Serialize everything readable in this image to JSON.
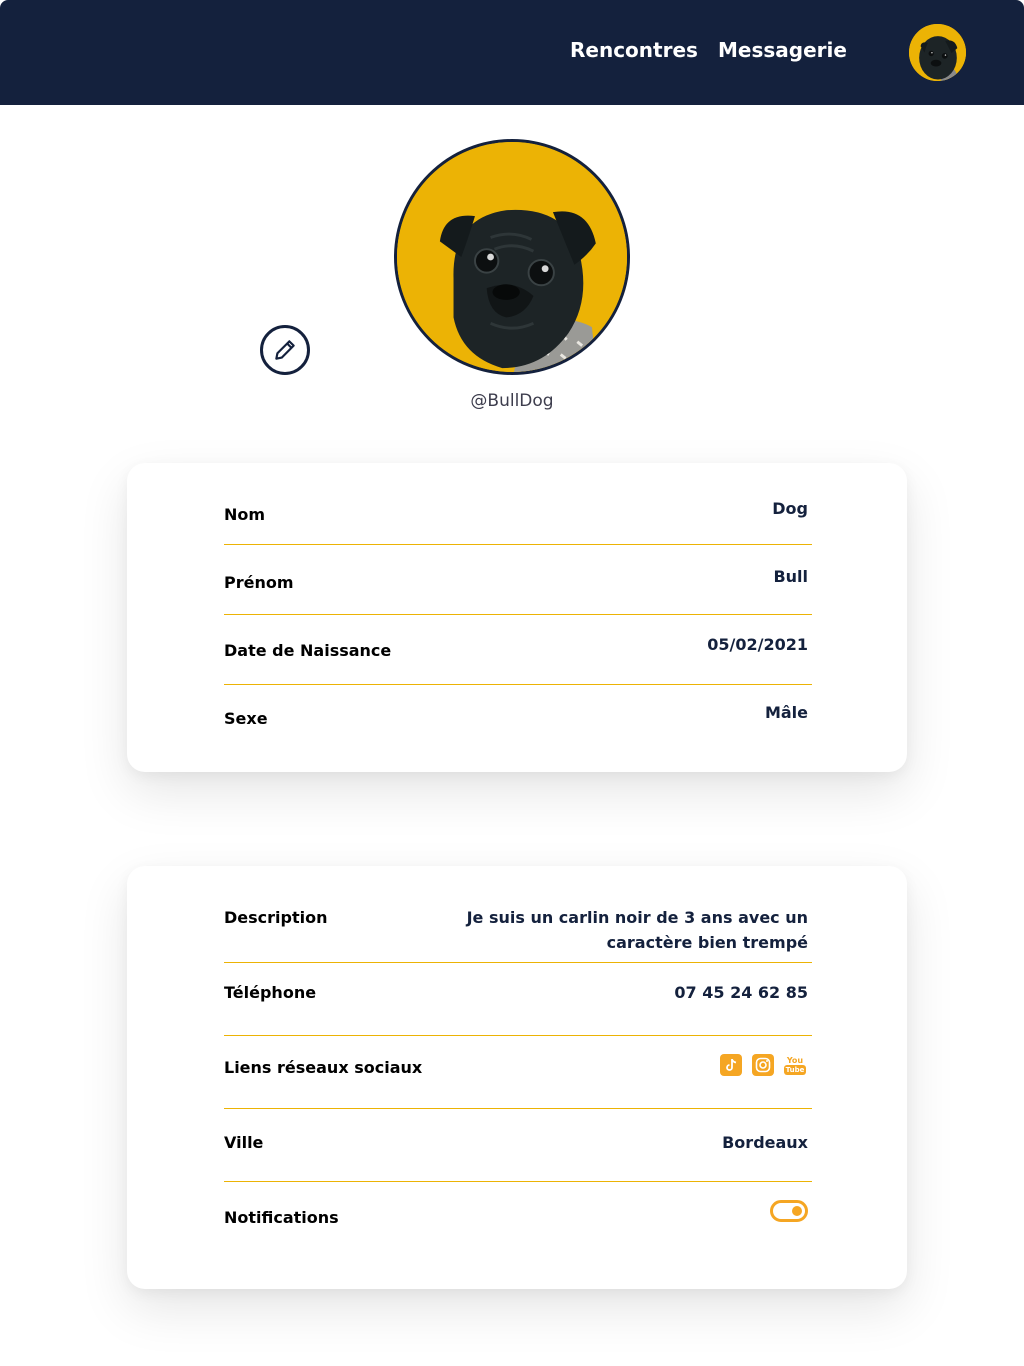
{
  "nav": {
    "links": [
      {
        "label": "Rencontres"
      },
      {
        "label": "Messagerie"
      }
    ]
  },
  "profile": {
    "username": "@BullDog"
  },
  "identity": {
    "rows": [
      {
        "label": "Nom",
        "value": "Dog"
      },
      {
        "label": "Prénom",
        "value": "Bull"
      },
      {
        "label": "Date de Naissance",
        "value": "05/02/2021"
      },
      {
        "label": "Sexe",
        "value": "Mâle"
      }
    ]
  },
  "details": {
    "description": {
      "label": "Description",
      "value_line1": "Je suis un carlin noir de 3 ans avec un",
      "value_line2": "caractère bien trempé"
    },
    "phone": {
      "label": "Téléphone",
      "value": "07 45 24 62 85"
    },
    "social": {
      "label": "Liens réseaux sociaux",
      "icons": [
        "tiktok-icon",
        "instagram-icon",
        "youtube-icon"
      ],
      "youtube_text_top": "You",
      "youtube_text_bottom": "Tube"
    },
    "city": {
      "label": "Ville",
      "value": "Bordeaux"
    },
    "notifications": {
      "label": "Notifications",
      "enabled": true
    }
  },
  "colors": {
    "navy": "#14213d",
    "accent": "#ecb305",
    "orange": "#f5a623"
  }
}
